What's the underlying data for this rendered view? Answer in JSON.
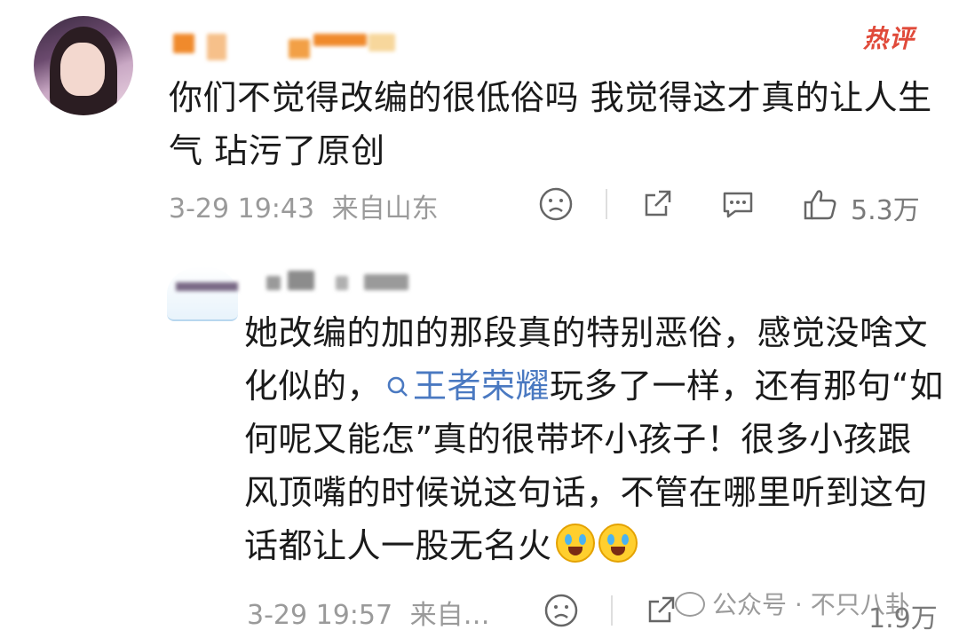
{
  "comments": [
    {
      "badge": "热评",
      "text": "你们不觉得改编的很低俗吗 我觉得这才真的让人生气 玷污了原创",
      "date": "3-29 19:43",
      "location": "来自山东",
      "likes": "5.3万"
    },
    {
      "text_before_topic": "她改编的加的那段真的特别恶俗，感觉没啥文化似的，",
      "topic": "王者荣耀",
      "text_after_topic": "玩多了一样，还有那句“如何呢又能怎”真的很带坏小孩子！很多小孩跟风顶嘴的时候说这句话，不管在哪里听到这句话都让人一股无名火",
      "date": "3-29 19:57",
      "location": "来自…",
      "likes": "1.9万"
    }
  ],
  "watermark": "公众号 · 不只八卦",
  "icons": [
    "sad-face-icon",
    "share-icon",
    "comment-icon",
    "thumbs-up-icon",
    "search-icon",
    "crying-laughing-emoji"
  ],
  "colors": {
    "hot_badge": "#e04a3a",
    "topic_link": "#4a79c1",
    "meta_gray": "#9a9a9a"
  }
}
